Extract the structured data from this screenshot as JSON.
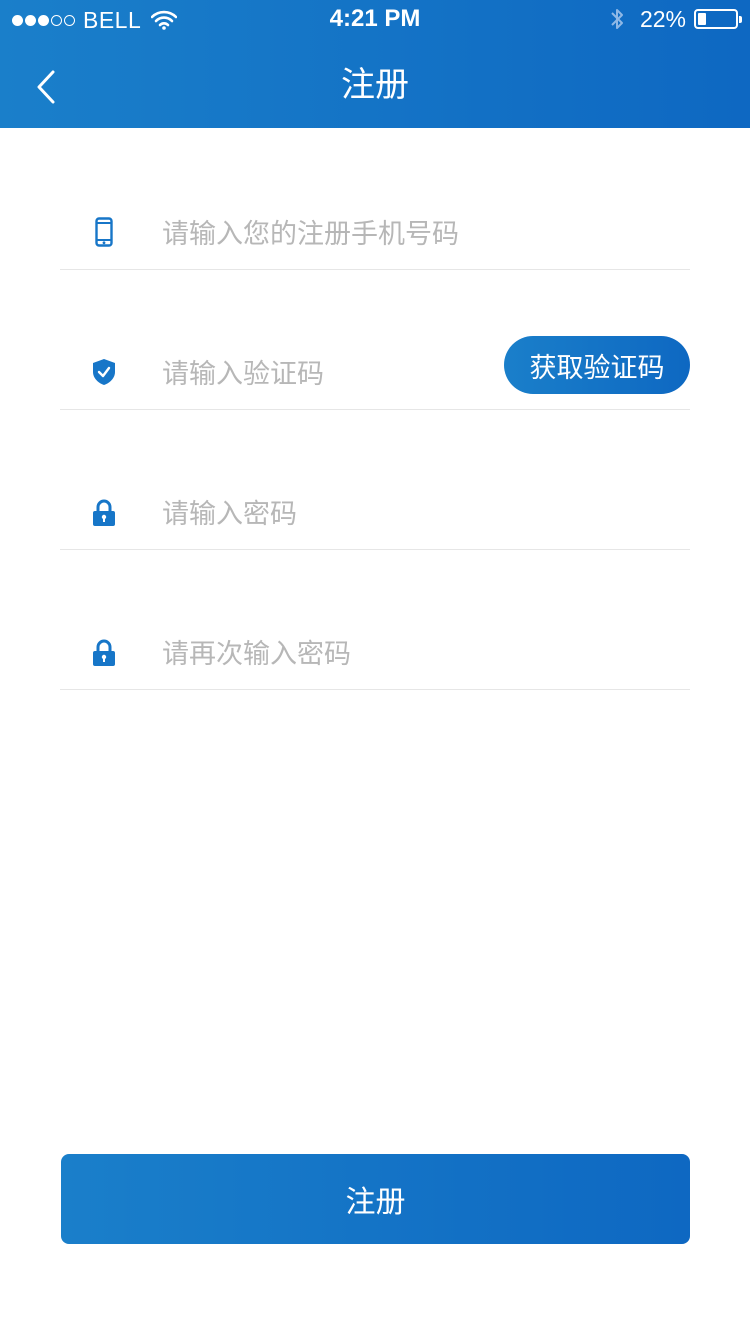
{
  "status_bar": {
    "carrier": "BELL",
    "signal_bars_full": 3,
    "signal_bars_total": 5,
    "time": "4:21 PM",
    "battery_percent": "22%",
    "battery_level": 0.22
  },
  "nav": {
    "back_icon": "chevron-left-icon",
    "title": "注册"
  },
  "form": {
    "phone": {
      "icon": "phone-icon",
      "placeholder": "请输入您的注册手机号码",
      "value": ""
    },
    "code": {
      "icon": "shield-check-icon",
      "placeholder": "请输入验证码",
      "value": "",
      "button_label": "获取验证码"
    },
    "password": {
      "icon": "lock-icon",
      "placeholder": "请输入密码",
      "value": ""
    },
    "confirm_password": {
      "icon": "lock-icon",
      "placeholder": "请再次输入密码",
      "value": ""
    }
  },
  "submit": {
    "label": "注册"
  },
  "colors": {
    "primary": "#1a7fca",
    "primary_dark": "#0e68c2",
    "placeholder": "#b7b7b7",
    "divider": "#e6e6e6"
  }
}
